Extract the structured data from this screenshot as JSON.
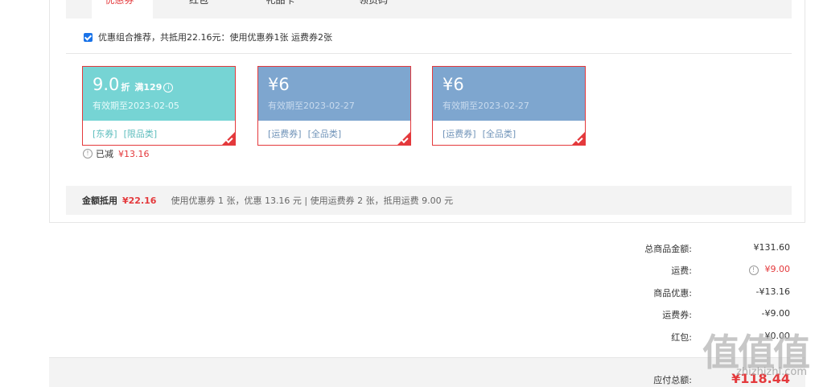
{
  "tabs": [
    {
      "label": "优惠券",
      "dot": "•"
    },
    {
      "label": "红包",
      "dot": ""
    },
    {
      "label": "礼品卡",
      "dot": "•"
    },
    {
      "label": "领货码",
      "dot": ""
    }
  ],
  "combo_text": "优惠组合推荐，共抵用22.16元：使用优惠券1张 运费券2张",
  "coupons": [
    {
      "value": "9.0",
      "unit": "折",
      "condition": "满129",
      "info": "i",
      "validity": "有效期至2023-02-05",
      "tag1": "[东券]",
      "tag2": "[限品类]",
      "head_color": "#76d4d4",
      "tag_color": "#5bbcbc"
    },
    {
      "value": "¥6",
      "unit": "",
      "condition": "",
      "info": "",
      "validity": "有效期至2023-02-27",
      "tag1": "[运费券]",
      "tag2": "[全品类]",
      "head_color": "#7ea6cf",
      "tag_color": "#6f93b8"
    },
    {
      "value": "¥6",
      "unit": "",
      "condition": "",
      "info": "",
      "validity": "有效期至2023-02-27",
      "tag1": "[运费券]",
      "tag2": "[全品类]",
      "head_color": "#7ea6cf",
      "tag_color": "#6f93b8"
    }
  ],
  "reduced": {
    "label": "已减",
    "amount": "¥13.16"
  },
  "summary": {
    "label": "金额抵用",
    "amount": "¥22.16",
    "detail": "使用优惠券 1 张，优惠 13.16 元  | 使用运费券 2 张，抵用运费 9.00 元"
  },
  "totals": [
    {
      "label": "总商品金额:",
      "value": "¥131.60"
    },
    {
      "label": "运费:",
      "value": "¥9.00"
    },
    {
      "label": "商品优惠:",
      "value": "-¥13.16"
    },
    {
      "label": "运费券:",
      "value": "-¥9.00"
    },
    {
      "label": "红包:",
      "value": "¥0.00"
    }
  ],
  "payable": {
    "label": "应付总额:",
    "value": "¥118.44"
  },
  "watermark": {
    "glyphs": "值值值",
    "site": "zhizhizhi.com"
  },
  "colors": {
    "accent": "#e4393c",
    "freight": "#e4393c"
  }
}
